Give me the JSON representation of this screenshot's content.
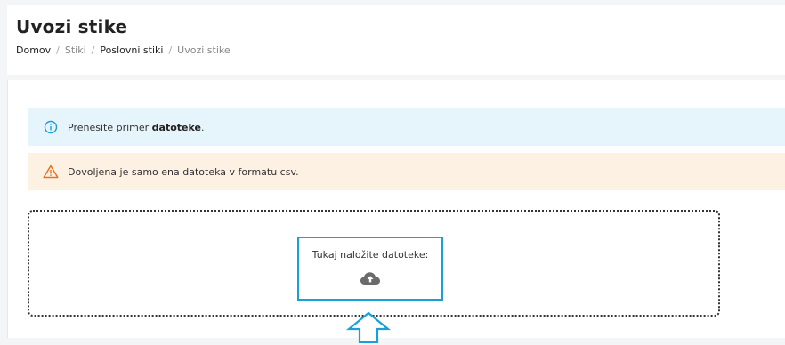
{
  "header": {
    "title": "Uvozi stike",
    "breadcrumb": [
      {
        "label": "Domov",
        "active": true
      },
      {
        "label": "Stiki",
        "active": false
      },
      {
        "label": "Poslovni stiki",
        "active": true
      },
      {
        "label": "Uvozi stike",
        "active": false
      }
    ],
    "separator": "/"
  },
  "alerts": {
    "info": {
      "text_before": "Prenesite primer ",
      "link_text": "datoteke",
      "text_after": "."
    },
    "warning": {
      "text": "Dovoljena je samo ena datoteka v formatu csv."
    }
  },
  "dropzone": {
    "label": "Tukaj naložite datoteke:",
    "icon": "cloud-upload-icon"
  },
  "colors": {
    "info_bg": "#e6f5fb",
    "info_icon": "#1a9fd9",
    "warning_bg": "#fdf1e4",
    "warning_icon": "#e8731a",
    "highlight": "#1a9fd9",
    "cloud_icon": "#6b6b6b"
  }
}
